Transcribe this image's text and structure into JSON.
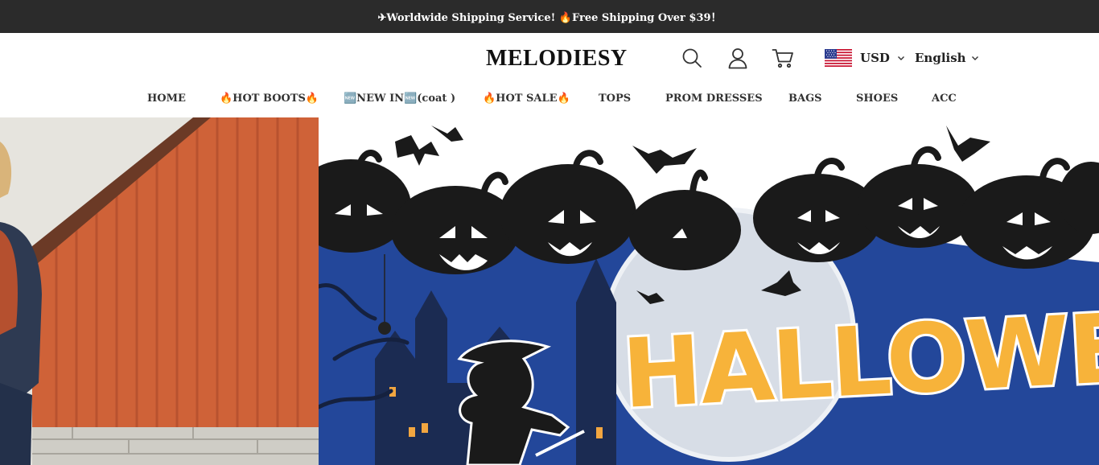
{
  "announcement": {
    "text": "✈Worldwide Shipping Service! 🔥Free Shipping Over $39！"
  },
  "header": {
    "logo": "MELODIESY",
    "icons": [
      "search-icon",
      "account-icon",
      "cart-icon"
    ],
    "currency": {
      "flag": "us-flag-icon",
      "code": "USD"
    },
    "language": "English"
  },
  "nav": {
    "items": [
      {
        "label": "HOME"
      },
      {
        "label": "🔥HOT BOOTS🔥"
      },
      {
        "label": "🆕NEW IN🆕(coat )"
      },
      {
        "label": "🔥HOT SALE🔥"
      },
      {
        "label": "TOPS"
      },
      {
        "label": "PROM DRESSES"
      },
      {
        "label": "BAGS"
      },
      {
        "label": "SHOES"
      },
      {
        "label": "ACC"
      }
    ]
  },
  "hero": {
    "banner_text": "HALLOWEEN"
  },
  "colors": {
    "announce_bg": "#2b2b2b",
    "halloween_orange": "#f7b33a",
    "night_blue": "#23479a",
    "barn_orange": "#d0643a"
  }
}
